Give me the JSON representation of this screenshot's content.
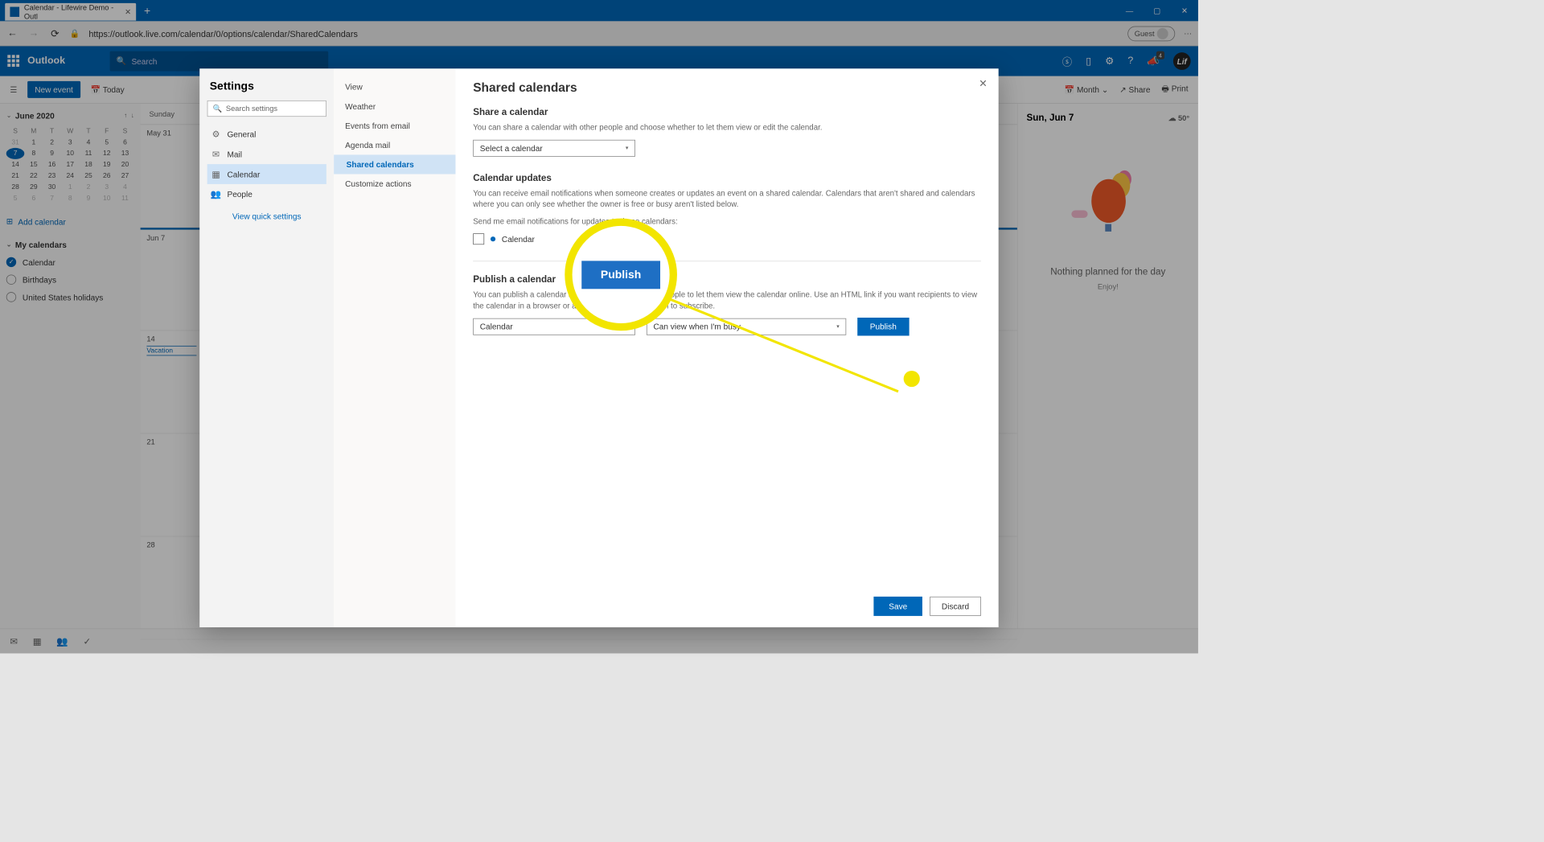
{
  "browser": {
    "tab_title": "Calendar - Lifewire Demo - Outl",
    "url": "https://outlook.live.com/calendar/0/options/calendar/SharedCalendars",
    "guest": "Guest"
  },
  "header": {
    "brand": "Outlook",
    "search_placeholder": "Search"
  },
  "toolbar": {
    "new_event": "New event",
    "today": "Today",
    "month": "Month",
    "share": "Share",
    "print": "Print"
  },
  "minicalendar": {
    "month": "June 2020",
    "dow": [
      "S",
      "M",
      "T",
      "W",
      "T",
      "F",
      "S"
    ],
    "rows": [
      [
        "31",
        "1",
        "2",
        "3",
        "4",
        "5",
        "6"
      ],
      [
        "7",
        "8",
        "9",
        "10",
        "11",
        "12",
        "13"
      ],
      [
        "14",
        "15",
        "16",
        "17",
        "18",
        "19",
        "20"
      ],
      [
        "21",
        "22",
        "23",
        "24",
        "25",
        "26",
        "27"
      ],
      [
        "28",
        "29",
        "30",
        "1",
        "2",
        "3",
        "4"
      ],
      [
        "5",
        "6",
        "7",
        "8",
        "9",
        "10",
        "11"
      ]
    ],
    "today": "7",
    "add_calendar": "Add calendar",
    "my_calendars": "My calendars",
    "calendars": [
      "Calendar",
      "Birthdays",
      "United States holidays"
    ]
  },
  "grid": {
    "sunday_label": "Sunday",
    "may31": "May 31",
    "jun7": "Jun 7",
    "d14": "14",
    "vacation": "Vacation",
    "d21": "21",
    "d28": "28"
  },
  "rightpane": {
    "date": "Sun, Jun 7",
    "temp": "50°",
    "nothing": "Nothing planned for the day",
    "enjoy": "Enjoy!"
  },
  "settings": {
    "title": "Settings",
    "search_placeholder": "Search settings",
    "col1": [
      "General",
      "Mail",
      "Calendar",
      "People"
    ],
    "quick": "View quick settings",
    "col2": [
      "View",
      "Weather",
      "Events from email",
      "Agenda mail",
      "Shared calendars",
      "Customize actions"
    ],
    "panel_title": "Shared calendars",
    "share": {
      "heading": "Share a calendar",
      "desc": "You can share a calendar with other people and choose whether to let them view or edit the calendar.",
      "select": "Select a calendar"
    },
    "updates": {
      "heading": "Calendar updates",
      "desc": "You can receive email notifications when someone creates or updates an event on a shared calendar. Calendars that aren't shared and calendars where you can only see whether the owner is free or busy aren't listed below.",
      "send_me": "Send me email notifications for updates to these calendars:",
      "calendar": "Calendar"
    },
    "publish": {
      "heading": "Publish a calendar",
      "desc": "You can publish a calendar and share a link with other people to let them view the calendar online. Use an HTML link if you want recipients to view the calendar in a browser or an ICS link if you want them to subscribe.",
      "cal_dd": "Calendar",
      "perm_dd": "Can view when I'm busy",
      "button": "Publish"
    },
    "save": "Save",
    "discard": "Discard"
  },
  "magnifier": {
    "label": "Publish"
  }
}
